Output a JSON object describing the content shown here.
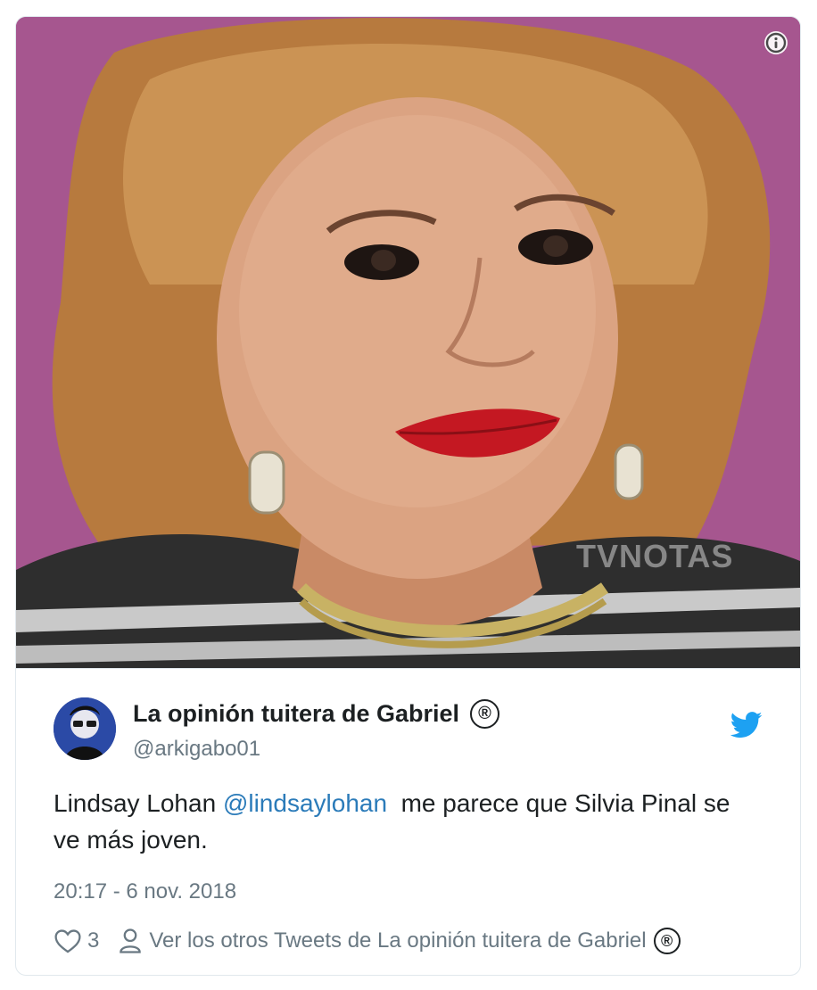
{
  "tweet": {
    "author_name": "La opinión tuitera de Gabriel",
    "author_badge": "®",
    "handle": "@arkigabo01",
    "text_before": "Lindsay Lohan ",
    "mention": "@lindsaylohan",
    "text_after": "  me parece que Silvia Pinal se ve más joven.",
    "timestamp": "20:17 - 6 nov. 2018",
    "like_count": "3",
    "more_tweets_label": "Ver los otros Tweets de La opinión tuitera de Gabriel",
    "trail_badge": "®"
  },
  "media": {
    "watermark": "TVNOTAS",
    "background_color": "#a6568f"
  },
  "icons": {
    "info": "info-icon",
    "bird": "twitter-bird-icon",
    "heart": "heart-icon",
    "person": "person-icon"
  },
  "colors": {
    "link": "#2b7bb9",
    "secondary_text": "#697882",
    "twitter_blue": "#1da1f2"
  }
}
